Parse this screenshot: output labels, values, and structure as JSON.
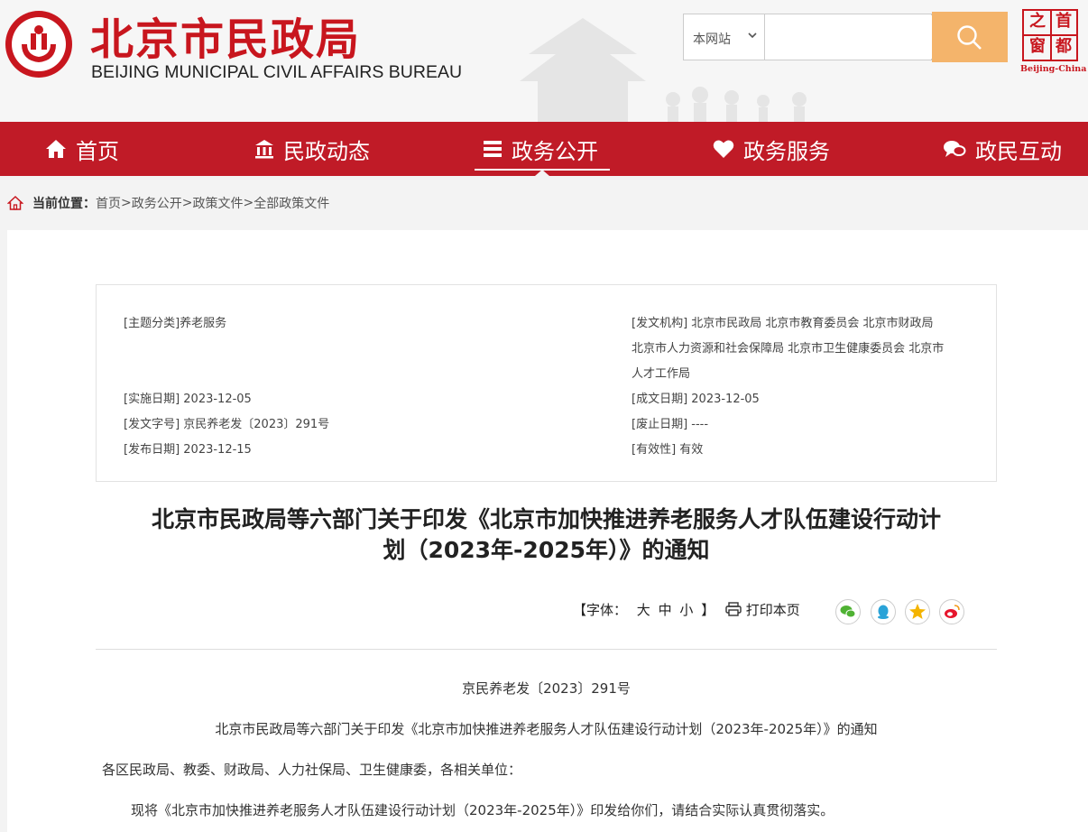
{
  "header": {
    "title_cn": "北京市民政局",
    "title_en": "BEIJING MUNICIPAL CIVIL AFFAIRS BUREAU",
    "search": {
      "scope_selected": "本网站",
      "placeholder": ""
    },
    "badge": {
      "chars": [
        "首",
        "都",
        "之",
        "窗"
      ],
      "en": "Beijing-China"
    },
    "accent": "#c8161e"
  },
  "nav": {
    "items": [
      {
        "label": "首页",
        "icon": "home-icon"
      },
      {
        "label": "民政动态",
        "icon": "building-icon"
      },
      {
        "label": "政务公开",
        "icon": "list-icon",
        "active": true
      },
      {
        "label": "政务服务",
        "icon": "heart-icon"
      },
      {
        "label": "政民互动",
        "icon": "chat-icon"
      }
    ],
    "color": "#c01b27"
  },
  "breadcrumb": {
    "label": "当前位置：",
    "items": [
      "首页",
      "政务公开",
      "政策文件",
      "全部政策文件"
    ],
    "sep": ">"
  },
  "meta": {
    "topic": "[主题分类]养老服务",
    "effective_date": "[实施日期] 2023-12-05",
    "doc_number": "[发文字号] 京民养老发〔2023〕291号",
    "publish_date": "[发布日期] 2023-12-15",
    "issuer_lines": [
      "[发文机构] 北京市民政局 北京市教育委员会 北京市财政局",
      "北京市人力资源和社会保障局 北京市卫生健康委员会 北京市",
      "人才工作局"
    ],
    "written_date": "[成文日期] 2023-12-05",
    "abolish_date": "[废止日期] ----",
    "validity": "[有效性] 有效"
  },
  "document": {
    "title_line1": "北京市民政局等六部门关于印发《北京市加快推进养老服务人才队伍建设行动计",
    "title_line2": "划（2023年-2025年）》的通知",
    "font_label": "【字体：",
    "font_sizes": [
      "大",
      "中",
      "小"
    ],
    "font_close": "】",
    "print_label": "打印本页",
    "share": [
      "wechat-icon",
      "qq-icon",
      "qzone-icon",
      "weibo-icon"
    ],
    "doc_number": "京民养老发〔2023〕291号",
    "subtitle": "北京市民政局等六部门关于印发《北京市加快推进养老服务人才队伍建设行动计划（2023年-2025年）》的通知",
    "addressee": "各区民政局、教委、财政局、人力社保局、卫生健康委，各相关单位：",
    "para1": "现将《北京市加快推进养老服务人才队伍建设行动计划（2023年-2025年）》印发给你们，请结合实际认真贯彻落实。"
  }
}
